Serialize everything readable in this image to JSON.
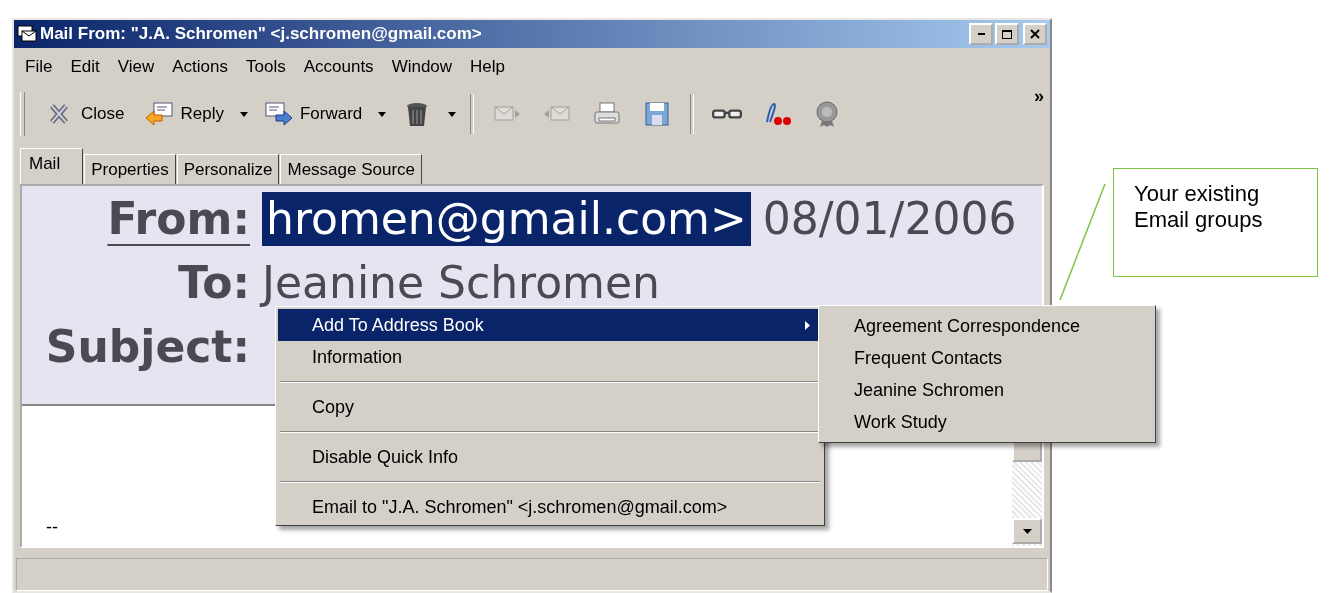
{
  "window": {
    "title": "Mail From: \"J.A. Schromen\" <j.schromen@gmail.com>"
  },
  "menu_bar": [
    "File",
    "Edit",
    "View",
    "Actions",
    "Tools",
    "Accounts",
    "Window",
    "Help"
  ],
  "toolbar": [
    {
      "kind": "close",
      "label": "Close",
      "disabled": false
    },
    {
      "kind": "reply",
      "label": "Reply",
      "dropdown": true,
      "disabled": false
    },
    {
      "kind": "forward",
      "label": "Forward",
      "dropdown": true,
      "disabled": false
    },
    {
      "kind": "trash",
      "dropdown": true,
      "disabled": false
    },
    {
      "kind": "separator"
    },
    {
      "kind": "next",
      "disabled": true
    },
    {
      "kind": "prev",
      "disabled": true
    },
    {
      "kind": "print",
      "disabled": false
    },
    {
      "kind": "save",
      "disabled": false
    },
    {
      "kind": "separator"
    },
    {
      "kind": "glasses",
      "disabled": false
    },
    {
      "kind": "sign",
      "disabled": false
    },
    {
      "kind": "seal",
      "disabled": false
    }
  ],
  "toolbar_overflow": "»",
  "tabs": [
    {
      "label": "Mail",
      "selected": true
    },
    {
      "label": "Properties",
      "selected": false
    },
    {
      "label": "Personalize",
      "selected": false
    },
    {
      "label": "Message Source",
      "selected": false
    }
  ],
  "header": [
    {
      "label": "From:",
      "value": "hromen@gmail.com>",
      "value_selected": true,
      "extra": "08/01/2006",
      "underlined": true
    },
    {
      "label": "To:",
      "value": "Jeanine Schromen",
      "value_selected": false,
      "underlined": false
    },
    {
      "label": "Subject:",
      "underlined": false
    }
  ],
  "body": {
    "text": "--"
  },
  "context_menu": [
    {
      "kind": "item",
      "label": "Add To Address Book",
      "selected": true,
      "submenu": true
    },
    {
      "kind": "item",
      "label": "Information",
      "selected": false,
      "submenu": false
    },
    {
      "kind": "separator"
    },
    {
      "kind": "item",
      "label": "Copy",
      "selected": false,
      "submenu": false
    },
    {
      "kind": "separator"
    },
    {
      "kind": "item",
      "label": "Disable Quick Info",
      "selected": false,
      "submenu": false
    },
    {
      "kind": "separator"
    },
    {
      "kind": "item",
      "label": "Email to \"J.A. Schromen\" <j.schromen@gmail.com>",
      "selected": false,
      "submenu": false
    }
  ],
  "submenu": [
    {
      "label": "Agreement Correspondence",
      "selected": false
    },
    {
      "label": "Frequent Contacts",
      "selected": false
    },
    {
      "label": "Jeanine Schromen",
      "selected": false
    },
    {
      "label": "Work Study",
      "selected": false
    }
  ],
  "callout": {
    "text": "Your existing Email groups"
  }
}
